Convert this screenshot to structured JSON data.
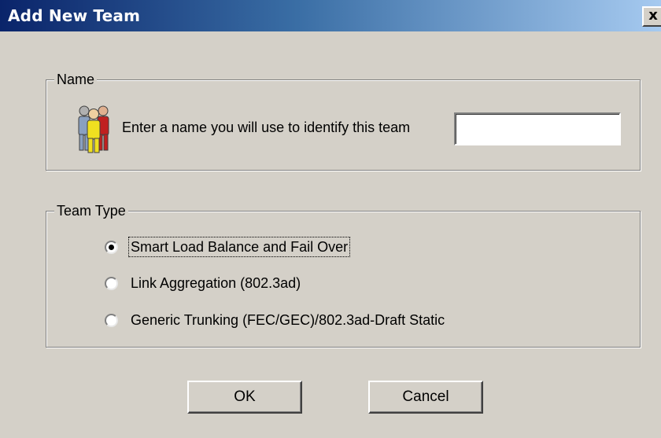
{
  "window": {
    "title": "Add New Team",
    "close_label": "x"
  },
  "name_group": {
    "legend": "Name",
    "icon": "team-people-icon",
    "prompt": "Enter a name you will use to identify this team",
    "input_value": ""
  },
  "team_type_group": {
    "legend": "Team Type",
    "options": [
      {
        "label": "Smart Load Balance and Fail Over",
        "selected": true
      },
      {
        "label": "Link Aggregation (802.3ad)",
        "selected": false
      },
      {
        "label": "Generic Trunking (FEC/GEC)/802.3ad-Draft Static",
        "selected": false
      }
    ]
  },
  "buttons": {
    "ok_label": "OK",
    "cancel_label": "Cancel"
  },
  "colors": {
    "titlebar_start": "#0a246a",
    "titlebar_end": "#a6caf0",
    "dialog_bg": "#d4d0c8"
  }
}
